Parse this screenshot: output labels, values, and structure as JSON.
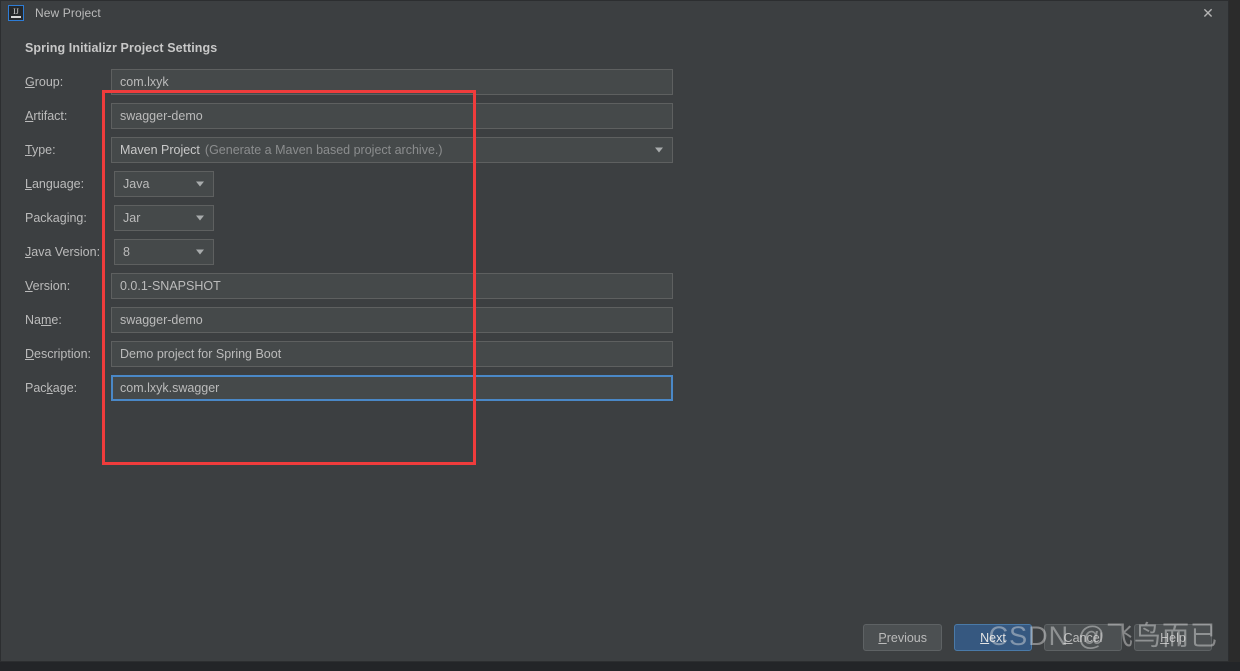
{
  "window": {
    "title": "New Project",
    "app_icon": "intellij-idea-icon",
    "close_icon": "close-icon"
  },
  "section": {
    "title": "Spring Initializr Project Settings"
  },
  "form": {
    "rows": [
      {
        "label_pre": "",
        "label_mnemonic": "G",
        "label_post": "roup:",
        "type": "text",
        "value": "com.lxyk"
      },
      {
        "label_pre": "",
        "label_mnemonic": "A",
        "label_post": "rtifact:",
        "type": "text",
        "value": "swagger-demo"
      },
      {
        "label_pre": "",
        "label_mnemonic": "T",
        "label_post": "ype:",
        "type": "combo-wide",
        "value": "Maven Project",
        "hint": "(Generate a Maven based project archive.)"
      },
      {
        "label_pre": "",
        "label_mnemonic": "L",
        "label_post": "anguage:",
        "type": "combo-small",
        "value": "Java"
      },
      {
        "label_pre": "Packa",
        "label_mnemonic": "g",
        "label_post": "ing:",
        "type": "combo-small",
        "value": "Jar"
      },
      {
        "label_pre": "",
        "label_mnemonic": "J",
        "label_post": "ava Version:",
        "type": "combo-small",
        "value": "8"
      },
      {
        "label_pre": "",
        "label_mnemonic": "V",
        "label_post": "ersion:",
        "type": "text",
        "value": "0.0.1-SNAPSHOT"
      },
      {
        "label_pre": "Na",
        "label_mnemonic": "m",
        "label_post": "e:",
        "type": "text",
        "value": "swagger-demo"
      },
      {
        "label_pre": "",
        "label_mnemonic": "D",
        "label_post": "escription:",
        "type": "text",
        "value": "Demo project for Spring Boot"
      },
      {
        "label_pre": "Pac",
        "label_mnemonic": "k",
        "label_post": "age:",
        "type": "text",
        "value": "com.lxyk.swagger",
        "focused": true
      }
    ]
  },
  "annotation": {
    "highlight_color": "#ef3c3c"
  },
  "footer": {
    "buttons": [
      {
        "pre": "",
        "mnemonic": "P",
        "post": "revious",
        "style": "normal"
      },
      {
        "pre": "",
        "mnemonic": "N",
        "post": "ext",
        "style": "default"
      },
      {
        "pre": "",
        "mnemonic": "C",
        "post": "ancel",
        "style": "normal"
      },
      {
        "pre": "",
        "mnemonic": "H",
        "post": "elp",
        "style": "normal"
      }
    ]
  },
  "watermark": {
    "text": "CSDN @飞鸟而已"
  },
  "colors": {
    "dialog_bg": "#3c3f41",
    "field_bg": "#45494a",
    "accent_blue": "#365880",
    "focus_blue": "#4a88c7",
    "annotation_red": "#ef3c3c"
  }
}
